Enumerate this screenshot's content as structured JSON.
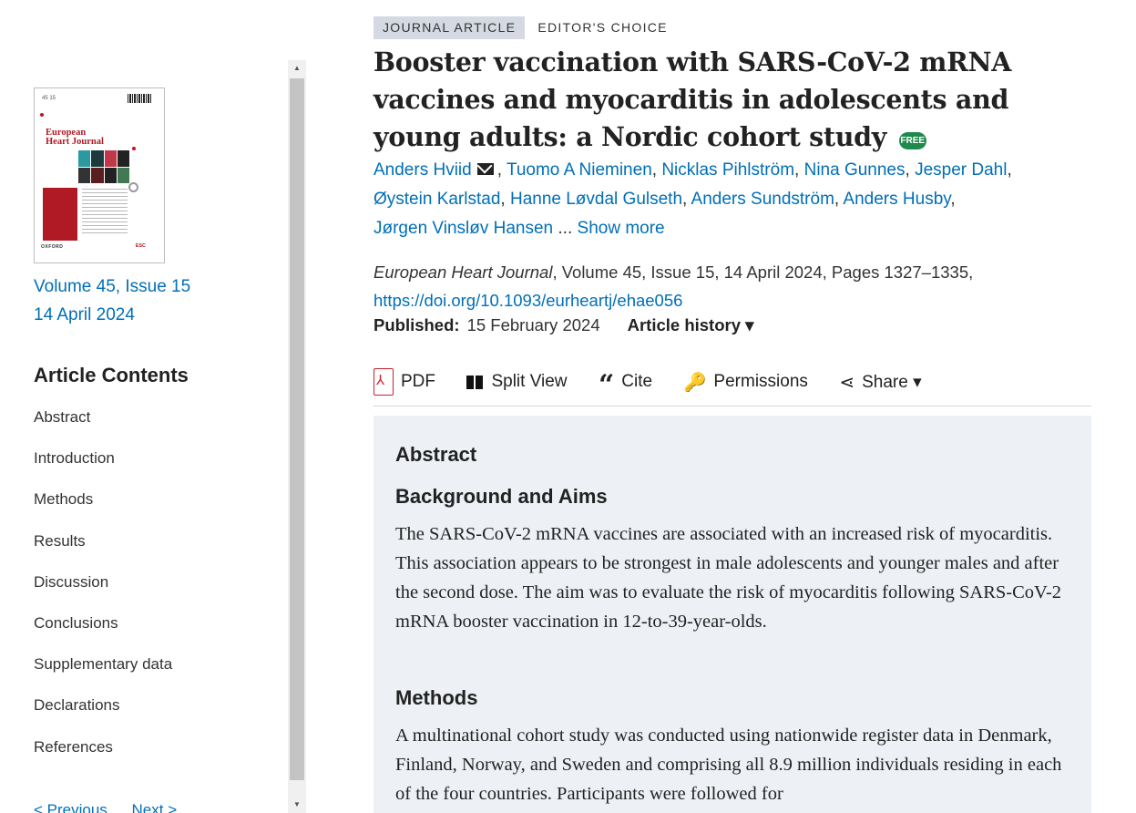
{
  "sidebar": {
    "cover": {
      "issue_numbers": "45  15",
      "journal_name_line1": "European",
      "journal_name_line2": "Heart Journal",
      "publisher_mark": "OXFORD",
      "society_mark": "ESC"
    },
    "volume_line": "Volume 45, Issue 15",
    "date_line": "14 April 2024",
    "contents_title": "Article Contents",
    "toc": [
      "Abstract",
      "Introduction",
      "Methods",
      "Results",
      "Discussion",
      "Conclusions",
      "Supplementary data",
      "Declarations",
      "References"
    ],
    "previous_label": "< Previous",
    "next_label": "Next >"
  },
  "article": {
    "tag_primary": "JOURNAL ARTICLE",
    "tag_secondary": "EDITOR'S CHOICE",
    "title": "Booster vaccination with SARS-CoV-2 mRNA vaccines and myocarditis in adolescents and young adults: a Nordic cohort study",
    "free_badge": "FREE",
    "authors": [
      "Anders Hviid",
      "Tuomo A Nieminen",
      "Nicklas Pihlström",
      "Nina Gunnes",
      "Jesper Dahl",
      "Øystein Karlstad",
      "Hanne Løvdal Gulseth",
      "Anders Sundström",
      "Anders Husby",
      "Jørgen Vinsløv Hansen"
    ],
    "author_ellipsis": "...",
    "show_more_label": "Show more",
    "journal_name": "European Heart Journal",
    "citation_details": ", Volume 45, Issue 15, 14 April 2024, Pages 1327–1335,",
    "doi": "https://doi.org/10.1093/eurheartj/ehae056",
    "published_label": "Published:",
    "published_date": "15 February 2024",
    "article_history_label": "Article history ▾"
  },
  "toolbar": {
    "pdf_label": "PDF",
    "split_view_label": "Split View",
    "cite_label": "Cite",
    "permissions_label": "Permissions",
    "share_label": "Share ▾"
  },
  "abstract": {
    "heading": "Abstract",
    "background_heading": "Background and Aims",
    "background_text": "The SARS-CoV-2 mRNA vaccines are associated with an increased risk of myocarditis. This association appears to be strongest in male adolescents and younger males and after the second dose. The aim was to evaluate the risk of myocarditis following SARS-CoV-2 mRNA booster vaccination in 12-to-39-year-olds.",
    "methods_heading": "Methods",
    "methods_text": "A multinational cohort study was conducted using nationwide register data in Denmark, Finland, Norway, and Sweden and comprising all 8.9 million individuals residing in each of the four countries. Participants were followed for"
  },
  "colors": {
    "link": "#006fb7",
    "free_badge": "#1f8a4c",
    "abstract_background": "#edf1f5",
    "tag_background": "#d5d9e3",
    "cover_accent": "#b01a25"
  }
}
